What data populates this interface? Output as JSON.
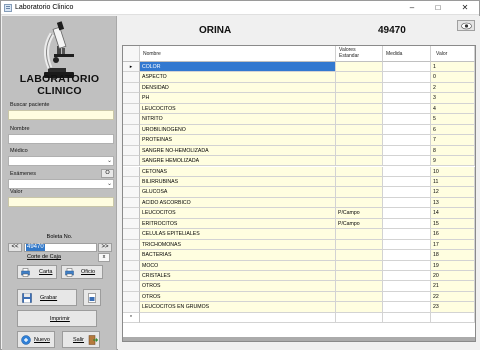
{
  "window": {
    "title": "Laboratorio Clinico"
  },
  "sidebar": {
    "brand_line1": "LABORATORIO",
    "brand_line2": "CLINICO",
    "buscar_label": "Buscar paciente",
    "nombre_label": "Nombre",
    "medico_label": "Médico",
    "examenes_label": "Exámenes",
    "o_button": "O",
    "valor_label": "Valor",
    "boleta_label": "Boleta No.",
    "boleta_value": "49470",
    "prev_button": "<<",
    "next_button": ">>",
    "corte_label": "Corte de Caja",
    "x_button": "x",
    "carta_button": "Carta",
    "oficio_button": "Oficio",
    "grabar_button": "Grabar",
    "imprimir_button": "Imprimir",
    "nuevo_button": "Nuevo",
    "salir_button": "Salir"
  },
  "main": {
    "exam_title": "ORINA",
    "boleta_number": "49470"
  },
  "grid": {
    "columns": [
      "Nombre",
      "Valores Estandar",
      "Medida",
      "Valor"
    ],
    "current_row_marker": "▸",
    "new_row_marker": "*",
    "rows": [
      {
        "nombre": "COLOR",
        "estandar": "",
        "medida": "",
        "valor": "1"
      },
      {
        "nombre": "ASPECTO",
        "estandar": "",
        "medida": "",
        "valor": "0"
      },
      {
        "nombre": "DENSIDAD",
        "estandar": "",
        "medida": "",
        "valor": "2"
      },
      {
        "nombre": "PH",
        "estandar": "",
        "medida": "",
        "valor": "3"
      },
      {
        "nombre": "LEUCOCITOS",
        "estandar": "",
        "medida": "",
        "valor": "4"
      },
      {
        "nombre": "NITRITO",
        "estandar": "",
        "medida": "",
        "valor": "5"
      },
      {
        "nombre": "UROBILINOGENO",
        "estandar": "",
        "medida": "",
        "valor": "6"
      },
      {
        "nombre": "PROTEINAS",
        "estandar": "",
        "medida": "",
        "valor": "7"
      },
      {
        "nombre": "SANGRE NO-HEMOLIZADA",
        "estandar": "",
        "medida": "",
        "valor": "8"
      },
      {
        "nombre": "SANGRE HEMOLIZADA",
        "estandar": "",
        "medida": "",
        "valor": "9"
      },
      {
        "nombre": "CETONAS",
        "estandar": "",
        "medida": "",
        "valor": "10"
      },
      {
        "nombre": "BILIRRUBINAS",
        "estandar": "",
        "medida": "",
        "valor": "11"
      },
      {
        "nombre": "GLUCOSA",
        "estandar": "",
        "medida": "",
        "valor": "12"
      },
      {
        "nombre": "ACIDO ASCORBICO",
        "estandar": "",
        "medida": "",
        "valor": "13"
      },
      {
        "nombre": "LEUCOCITOS",
        "estandar": "P/Campo",
        "medida": "",
        "valor": "14"
      },
      {
        "nombre": "ERITROCITOS",
        "estandar": "P/Campo",
        "medida": "",
        "valor": "15"
      },
      {
        "nombre": "CELULAS EPITELIALES",
        "estandar": "",
        "medida": "",
        "valor": "16"
      },
      {
        "nombre": "TRICHOMONAS",
        "estandar": "",
        "medida": "",
        "valor": "17"
      },
      {
        "nombre": "BACTERIAS",
        "estandar": "",
        "medida": "",
        "valor": "18"
      },
      {
        "nombre": "MOCO",
        "estandar": "",
        "medida": "",
        "valor": "19"
      },
      {
        "nombre": "CRISTALES",
        "estandar": "",
        "medida": "",
        "valor": "20"
      },
      {
        "nombre": "OTROS",
        "estandar": "",
        "medida": "",
        "valor": "21"
      },
      {
        "nombre": "OTROS",
        "estandar": "",
        "medida": "",
        "valor": "22"
      },
      {
        "nombre": "LEUCOCITOS EN GRUMOS",
        "estandar": "",
        "medida": "",
        "valor": "23"
      }
    ]
  },
  "colors": {
    "sidebar_bg": "#c0c0c0",
    "input_yellow": "#fffde0",
    "selection_blue": "#3278d0"
  }
}
